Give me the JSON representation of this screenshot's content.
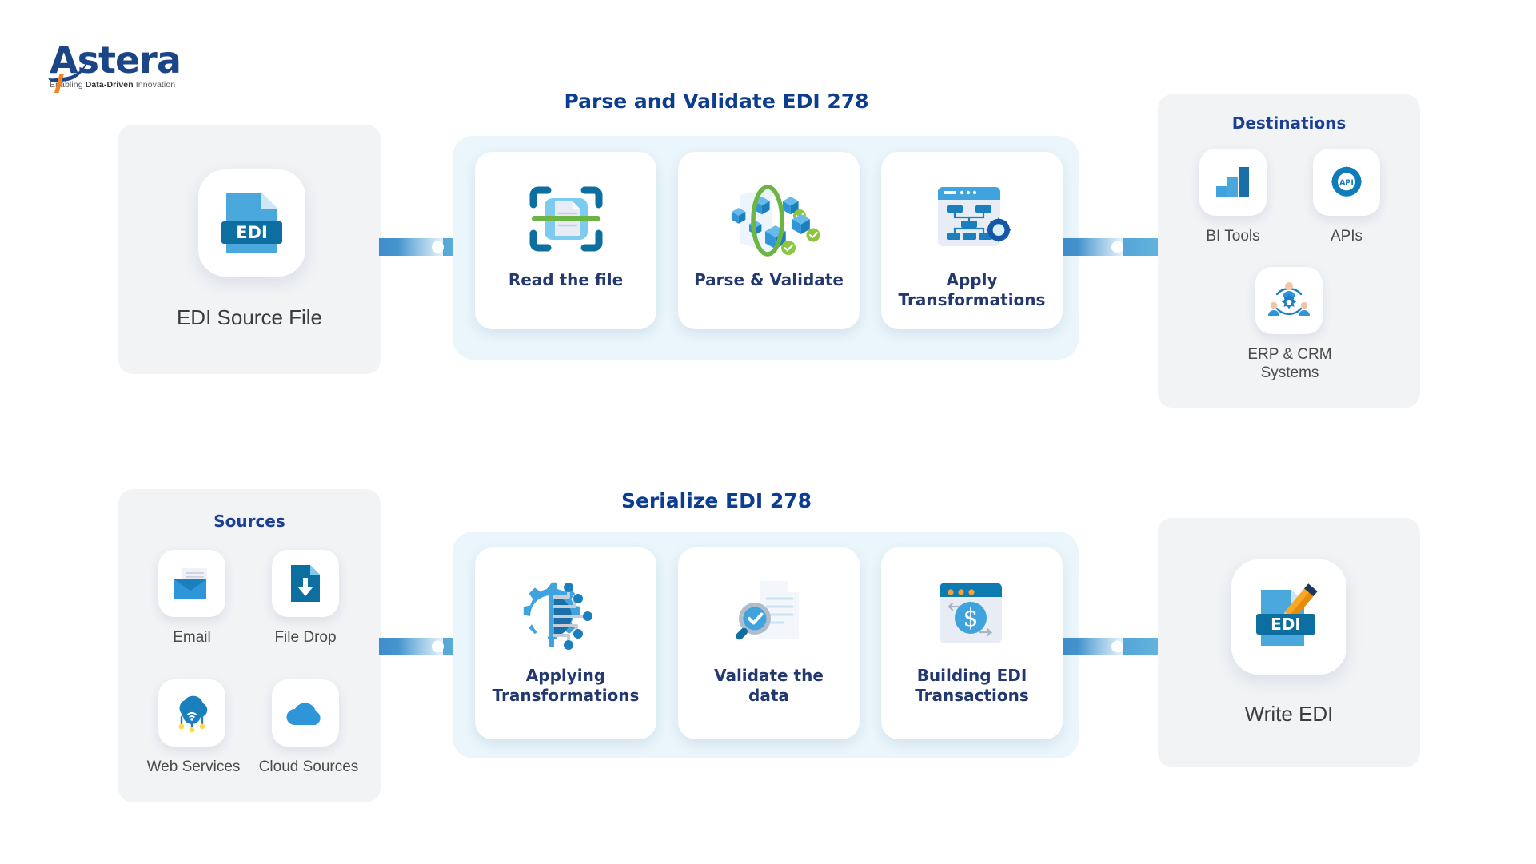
{
  "logo": {
    "word": "Astera",
    "tagline_pre": "Enabling ",
    "tagline_bold": "Data-Driven",
    "tagline_post": " Innovation"
  },
  "colors": {
    "brand_blue": "#1c4587",
    "accent_orange": "#f58220",
    "heading_blue": "#0b3d91",
    "card_label_blue": "#22386e",
    "panel_grey": "#f1f3f5",
    "band_blue": "#eaf6fb",
    "icon_blue": "#1b7fbd",
    "icon_light_blue": "#4aa8dd",
    "green": "#6cb544"
  },
  "top_flow": {
    "source": {
      "label": "EDI Source File",
      "icon": "edi-file-icon",
      "icon_text": "EDI"
    },
    "band_title": "Parse and Validate EDI 278",
    "steps": [
      {
        "label": "Read the file",
        "icon": "document-scan-icon"
      },
      {
        "label": "Parse & Validate",
        "icon": "data-cubes-validate-icon"
      },
      {
        "label": "Apply\nTransformations",
        "label_line1": "Apply",
        "label_line2": "Transformations",
        "icon": "flowchart-gear-icon"
      }
    ],
    "destinations": {
      "title": "Destinations",
      "items": [
        {
          "label": "BI Tools",
          "icon": "bar-chart-icon"
        },
        {
          "label": "APIs",
          "icon": "api-gear-icon",
          "icon_text": "API"
        },
        {
          "label": "ERP & CRM\nSystems",
          "label_line1": "ERP & CRM",
          "label_line2": "Systems",
          "icon": "erp-crm-people-gear-icon"
        }
      ]
    }
  },
  "bottom_flow": {
    "sources": {
      "title": "Sources",
      "items": [
        {
          "label": "Email",
          "icon": "email-envelope-icon"
        },
        {
          "label": "File Drop",
          "icon": "file-download-icon"
        },
        {
          "label": "Web Services",
          "icon": "cloud-wifi-icon"
        },
        {
          "label": "Cloud Sources",
          "icon": "cloud-icon"
        }
      ]
    },
    "band_title": "Serialize EDI 278",
    "steps": [
      {
        "label": "Applying\nTransformations",
        "label_line1": "Applying",
        "label_line2": "Transformations",
        "icon": "gear-circuit-icon"
      },
      {
        "label": "Validate the\ndata",
        "label_line1": "Validate the",
        "label_line2": "data",
        "icon": "document-check-magnifier-icon"
      },
      {
        "label": "Building EDI\nTransactions",
        "label_line1": "Building EDI",
        "label_line2": "Transactions",
        "icon": "browser-dollar-icon"
      }
    ],
    "destination": {
      "label": "Write EDI",
      "icon": "edi-write-pencil-icon",
      "icon_text": "EDI"
    }
  }
}
